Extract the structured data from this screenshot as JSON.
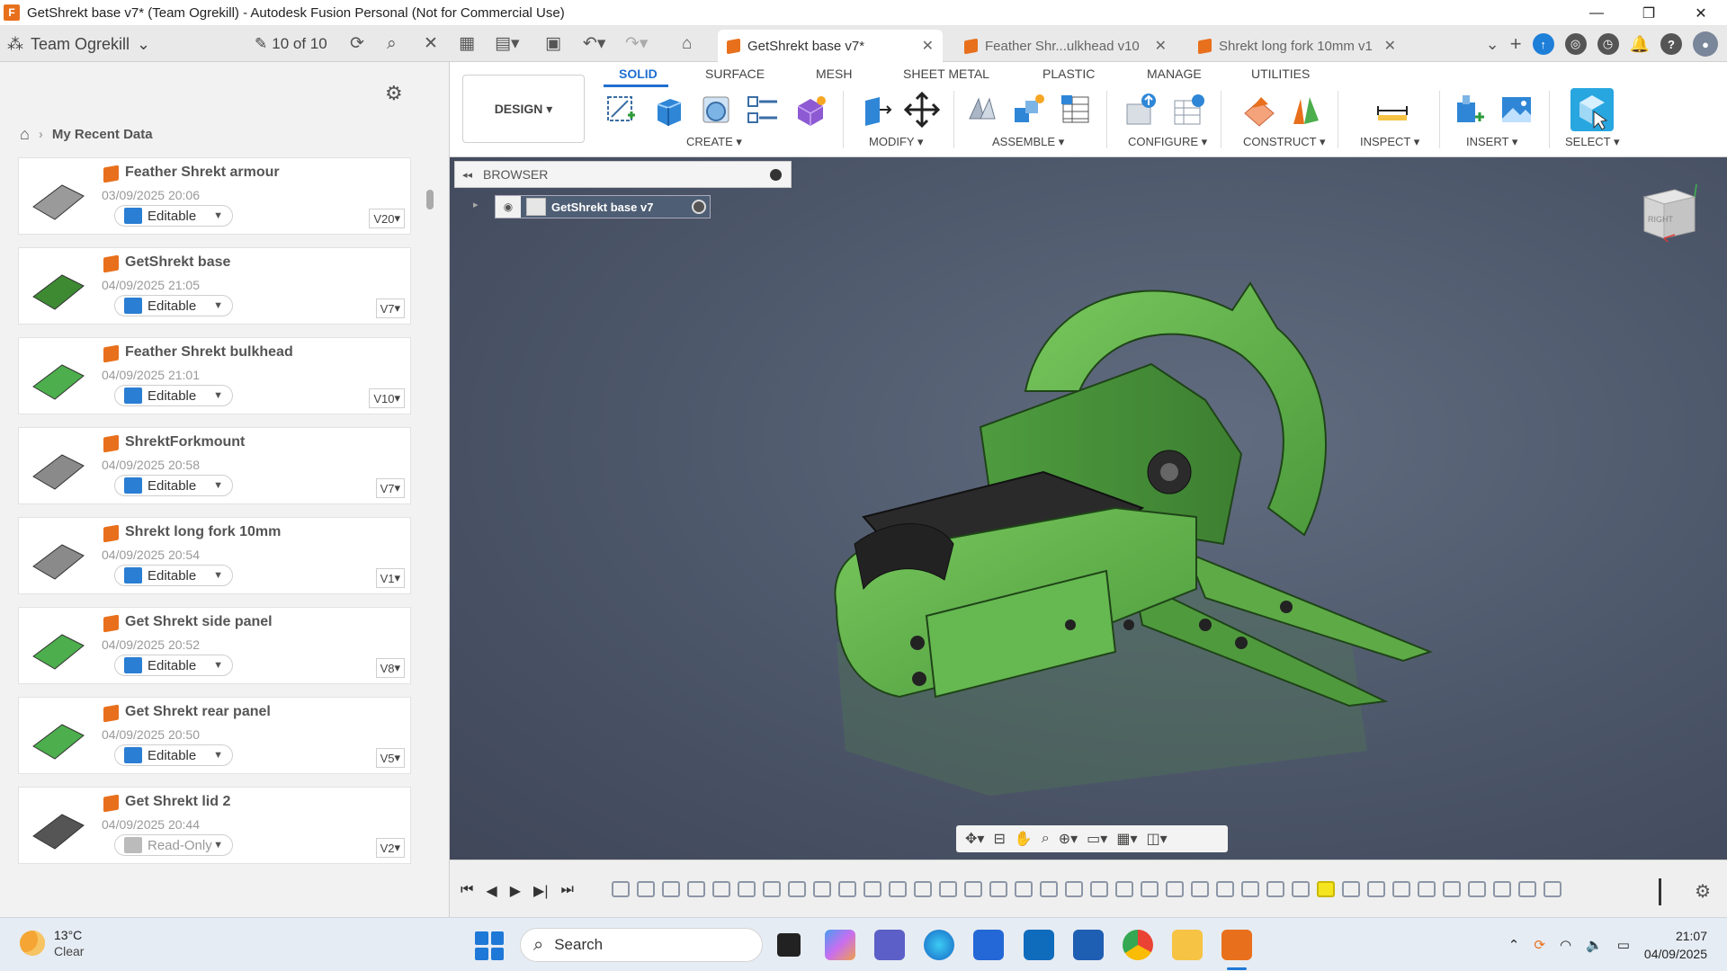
{
  "window": {
    "title": "GetShrekt base v7* (Team Ogrekill) - Autodesk Fusion Personal (Not for Commercial Use)",
    "app_icon_letter": "F",
    "controls": [
      "—",
      "❐",
      "✕"
    ]
  },
  "appbar": {
    "team": "Team Ogrekill",
    "version_count": "10 of 10",
    "tabs": [
      {
        "label": "GetShrekt base v7*",
        "active": true
      },
      {
        "label": "Feather Shr...ulkhead v10",
        "active": false
      },
      {
        "label": "Shrekt long fork 10mm v1",
        "active": false
      }
    ]
  },
  "data_panel": {
    "breadcrumb": "My Recent Data",
    "items": [
      {
        "name": "Feather Shrekt armour",
        "date": "03/09/2025 20:06",
        "status": "Editable",
        "version": "V20"
      },
      {
        "name": "GetShrekt base",
        "date": "04/09/2025 21:05",
        "status": "Editable",
        "version": "V7"
      },
      {
        "name": "Feather Shrekt bulkhead",
        "date": "04/09/2025 21:01",
        "status": "Editable",
        "version": "V10"
      },
      {
        "name": "ShrektForkmount",
        "date": "04/09/2025 20:58",
        "status": "Editable",
        "version": "V7"
      },
      {
        "name": "Shrekt long fork 10mm",
        "date": "04/09/2025 20:54",
        "status": "Editable",
        "version": "V1"
      },
      {
        "name": "Get Shrekt side panel",
        "date": "04/09/2025 20:52",
        "status": "Editable",
        "version": "V8"
      },
      {
        "name": "Get Shrekt rear panel",
        "date": "04/09/2025 20:50",
        "status": "Editable",
        "version": "V5"
      },
      {
        "name": "Get Shrekt lid 2",
        "date": "04/09/2025 20:44",
        "status": "Read-Only",
        "version": "V2"
      }
    ]
  },
  "toolbar": {
    "workspace": "DESIGN",
    "tabs": [
      "SOLID",
      "SURFACE",
      "MESH",
      "SHEET METAL",
      "PLASTIC",
      "MANAGE",
      "UTILITIES"
    ],
    "groups": [
      "CREATE",
      "MODIFY",
      "ASSEMBLE",
      "CONFIGURE",
      "CONSTRUCT",
      "INSPECT",
      "INSERT",
      "SELECT"
    ]
  },
  "browser": {
    "title": "BROWSER",
    "root": "GetShrekt base v7"
  },
  "viewcube": {
    "face": "RIGHT"
  },
  "taskbar": {
    "temperature": "13°C",
    "condition": "Clear",
    "search_placeholder": "Search",
    "time": "21:07",
    "date": "04/09/2025"
  },
  "colors": {
    "accent": "#1f6fd0",
    "fusion_orange": "#e8701c",
    "model_green": "#5cb04a",
    "viewport_bg": "#4c5669"
  }
}
